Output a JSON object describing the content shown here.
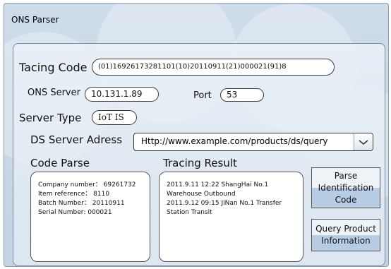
{
  "window": {
    "title": "ONS Parser"
  },
  "tracing_code": {
    "label": "Tacing Code",
    "value": "(01)16926173281101(10)20110911(21)000021(91)8"
  },
  "ons_server": {
    "label": "ONS Server",
    "value": "10.131.1.89"
  },
  "port": {
    "label": "Port",
    "value": "53"
  },
  "server_type": {
    "label": "Server Type",
    "value": "IoT IS"
  },
  "ds_server": {
    "label": "DS Server Adress",
    "value": "Http://www.example.com/products/ds/query"
  },
  "code_parse": {
    "title": "Code Parse",
    "rows": [
      "Company number： 69261732",
      "Item reference： 8110",
      "Batch Number： 20110911",
      "Serial Number: 000021"
    ]
  },
  "tracing_result": {
    "title": "Tracing Result",
    "rows": [
      "2011.9.11 12:22 ShangHai No.1",
      "Warehouse Outbound",
      "2011.9.12 09:15 JiNan No.1 Transfer",
      "Station Transit"
    ]
  },
  "buttons": {
    "parse_line1": "Parse",
    "parse_line2": "Identification",
    "parse_line3": "Code",
    "query_line1": "Query Product",
    "query_line2": "Information"
  }
}
